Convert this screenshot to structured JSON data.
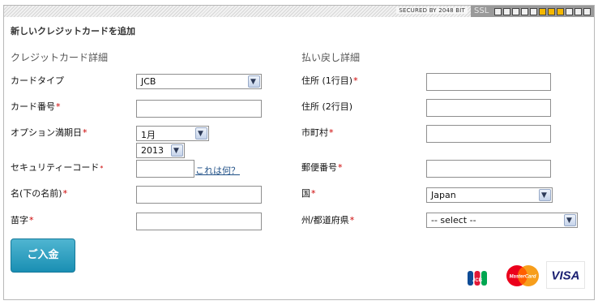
{
  "security": {
    "secured_text": "SECURED BY 2048 BIT",
    "ssl_label": "SSL",
    "strength_segments": 11,
    "strength_active": [
      5,
      6,
      7
    ]
  },
  "page_title": "新しいクレジットカードを追加",
  "card_details": {
    "title": "クレジットカード詳細",
    "card_type_label": "カードタイプ",
    "card_type_value": "JCB",
    "card_number_label": "カード番号",
    "expiry_label": "オプション満期日",
    "expiry_month": "1月",
    "expiry_year": "2013",
    "security_code_label": "セキュリティーコード",
    "security_code_help": "これは何？",
    "first_name_label": "名(下の名前)",
    "last_name_label": "苗字"
  },
  "refund_details": {
    "title": "払い戻し詳細",
    "address1_label": "住所 (1行目)",
    "address2_label": "住所 (2行目)",
    "city_label": "市町村",
    "postal_code_label": "郵便番号",
    "country_label": "国",
    "country_value": "Japan",
    "state_label": "州/都道府県",
    "state_value": "-- select --"
  },
  "pay_button_label": "ご入金",
  "card_logos": {
    "jcb": "JCB",
    "mastercard": "MasterCard",
    "visa": "VISA"
  },
  "colors": {
    "button": "#1a8fb3",
    "required": "#cc0000",
    "link": "#1e4f86",
    "ssl_active": "#f5b800"
  }
}
